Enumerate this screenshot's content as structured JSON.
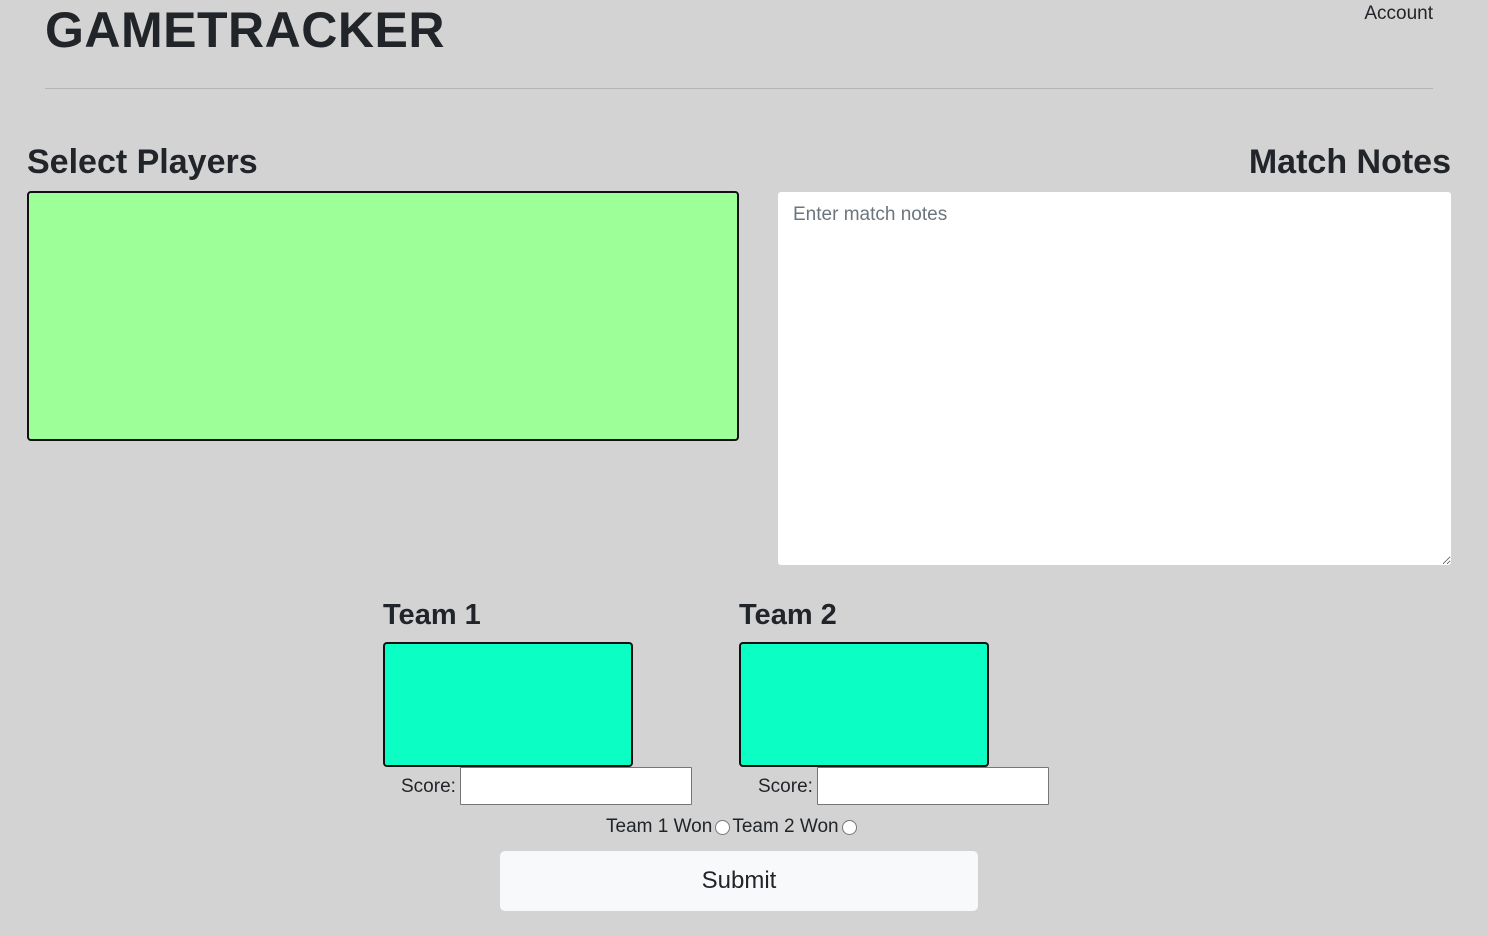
{
  "header": {
    "brand": "GAMETRACKER",
    "account_link": "Account"
  },
  "players": {
    "title": "Select Players"
  },
  "notes": {
    "title": "Match Notes",
    "placeholder": "Enter match notes",
    "value": ""
  },
  "teams": [
    {
      "title": "Team 1",
      "score_label": "Score:",
      "score_value": ""
    },
    {
      "title": "Team 2",
      "score_label": "Score:",
      "score_value": ""
    }
  ],
  "result": {
    "team1_won_label": "Team 1 Won",
    "team2_won_label": "Team 2 Won"
  },
  "submit_label": "Submit",
  "colors": {
    "background": "#d3d3d3",
    "player_pool": "#9cff98",
    "team_box": "#0bffc4",
    "submit_button": "#f8f9fa"
  }
}
